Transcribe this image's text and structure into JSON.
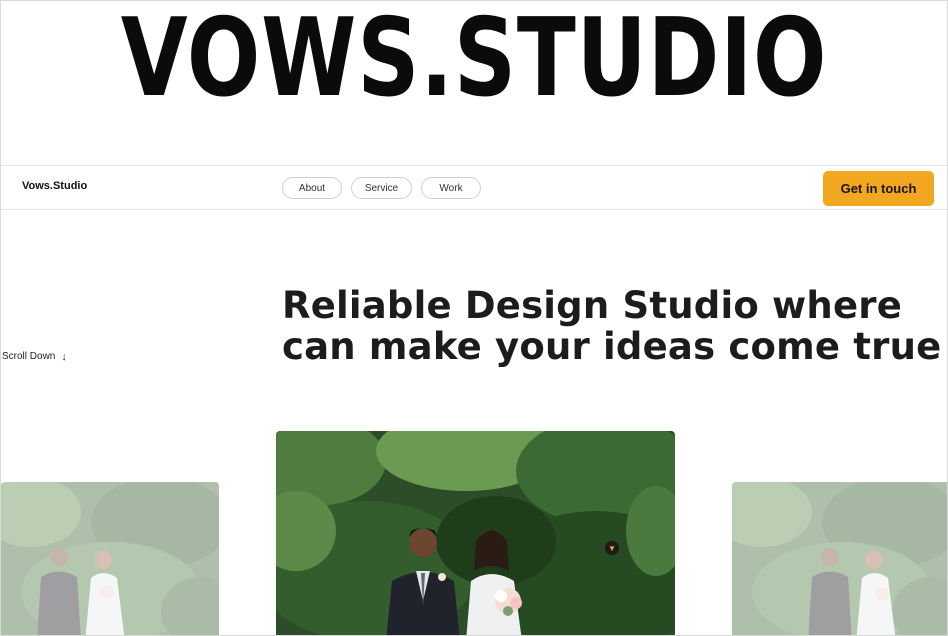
{
  "logo": {
    "text": "VOWS.STUDIO"
  },
  "navbar": {
    "brand": "Vows.Studio",
    "links": [
      "About",
      "Service",
      "Work"
    ],
    "cta_label": "Get in touch"
  },
  "hero": {
    "scroll_label": "Scroll Down",
    "scroll_icon": "arrow-down-icon",
    "headline": "Reliable Design Studio where can make your ideas come true"
  },
  "colors": {
    "accent": "#f1a820",
    "text": "#1c1c1c",
    "border": "#e6e6e6",
    "foliage": "#2f5a2c"
  },
  "gallery": {
    "images": [
      "wedding-couple-photo",
      "wedding-couple-photo",
      "wedding-couple-photo"
    ],
    "active_index": 1
  }
}
